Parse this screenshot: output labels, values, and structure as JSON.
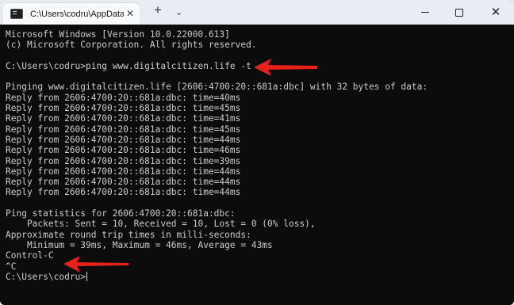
{
  "window": {
    "tab_title": "C:\\Users\\codru\\AppData\\Roa",
    "tab_close": "✕",
    "new_tab": "+",
    "dropdown": "⌄",
    "close_glyph": "✕"
  },
  "console": {
    "lines": [
      "Microsoft Windows [Version 10.0.22000.613]",
      "(c) Microsoft Corporation. All rights reserved.",
      "",
      "C:\\Users\\codru>ping www.digitalcitizen.life -t",
      "",
      "Pinging www.digitalcitizen.life [2606:4700:20::681a:dbc] with 32 bytes of data:",
      "Reply from 2606:4700:20::681a:dbc: time=40ms",
      "Reply from 2606:4700:20::681a:dbc: time=45ms",
      "Reply from 2606:4700:20::681a:dbc: time=41ms",
      "Reply from 2606:4700:20::681a:dbc: time=45ms",
      "Reply from 2606:4700:20::681a:dbc: time=44ms",
      "Reply from 2606:4700:20::681a:dbc: time=46ms",
      "Reply from 2606:4700:20::681a:dbc: time=39ms",
      "Reply from 2606:4700:20::681a:dbc: time=44ms",
      "Reply from 2606:4700:20::681a:dbc: time=44ms",
      "Reply from 2606:4700:20::681a:dbc: time=44ms",
      "",
      "Ping statistics for 2606:4700:20::681a:dbc:",
      "    Packets: Sent = 10, Received = 10, Lost = 0 (0% loss),",
      "Approximate round trip times in milli-seconds:",
      "    Minimum = 39ms, Maximum = 46ms, Average = 43ms",
      "Control-C",
      "^C",
      "C:\\Users\\codru>"
    ]
  },
  "colors": {
    "console_bg": "#0c0c0c",
    "console_text": "#cccccc",
    "arrow": "#e8201a"
  }
}
